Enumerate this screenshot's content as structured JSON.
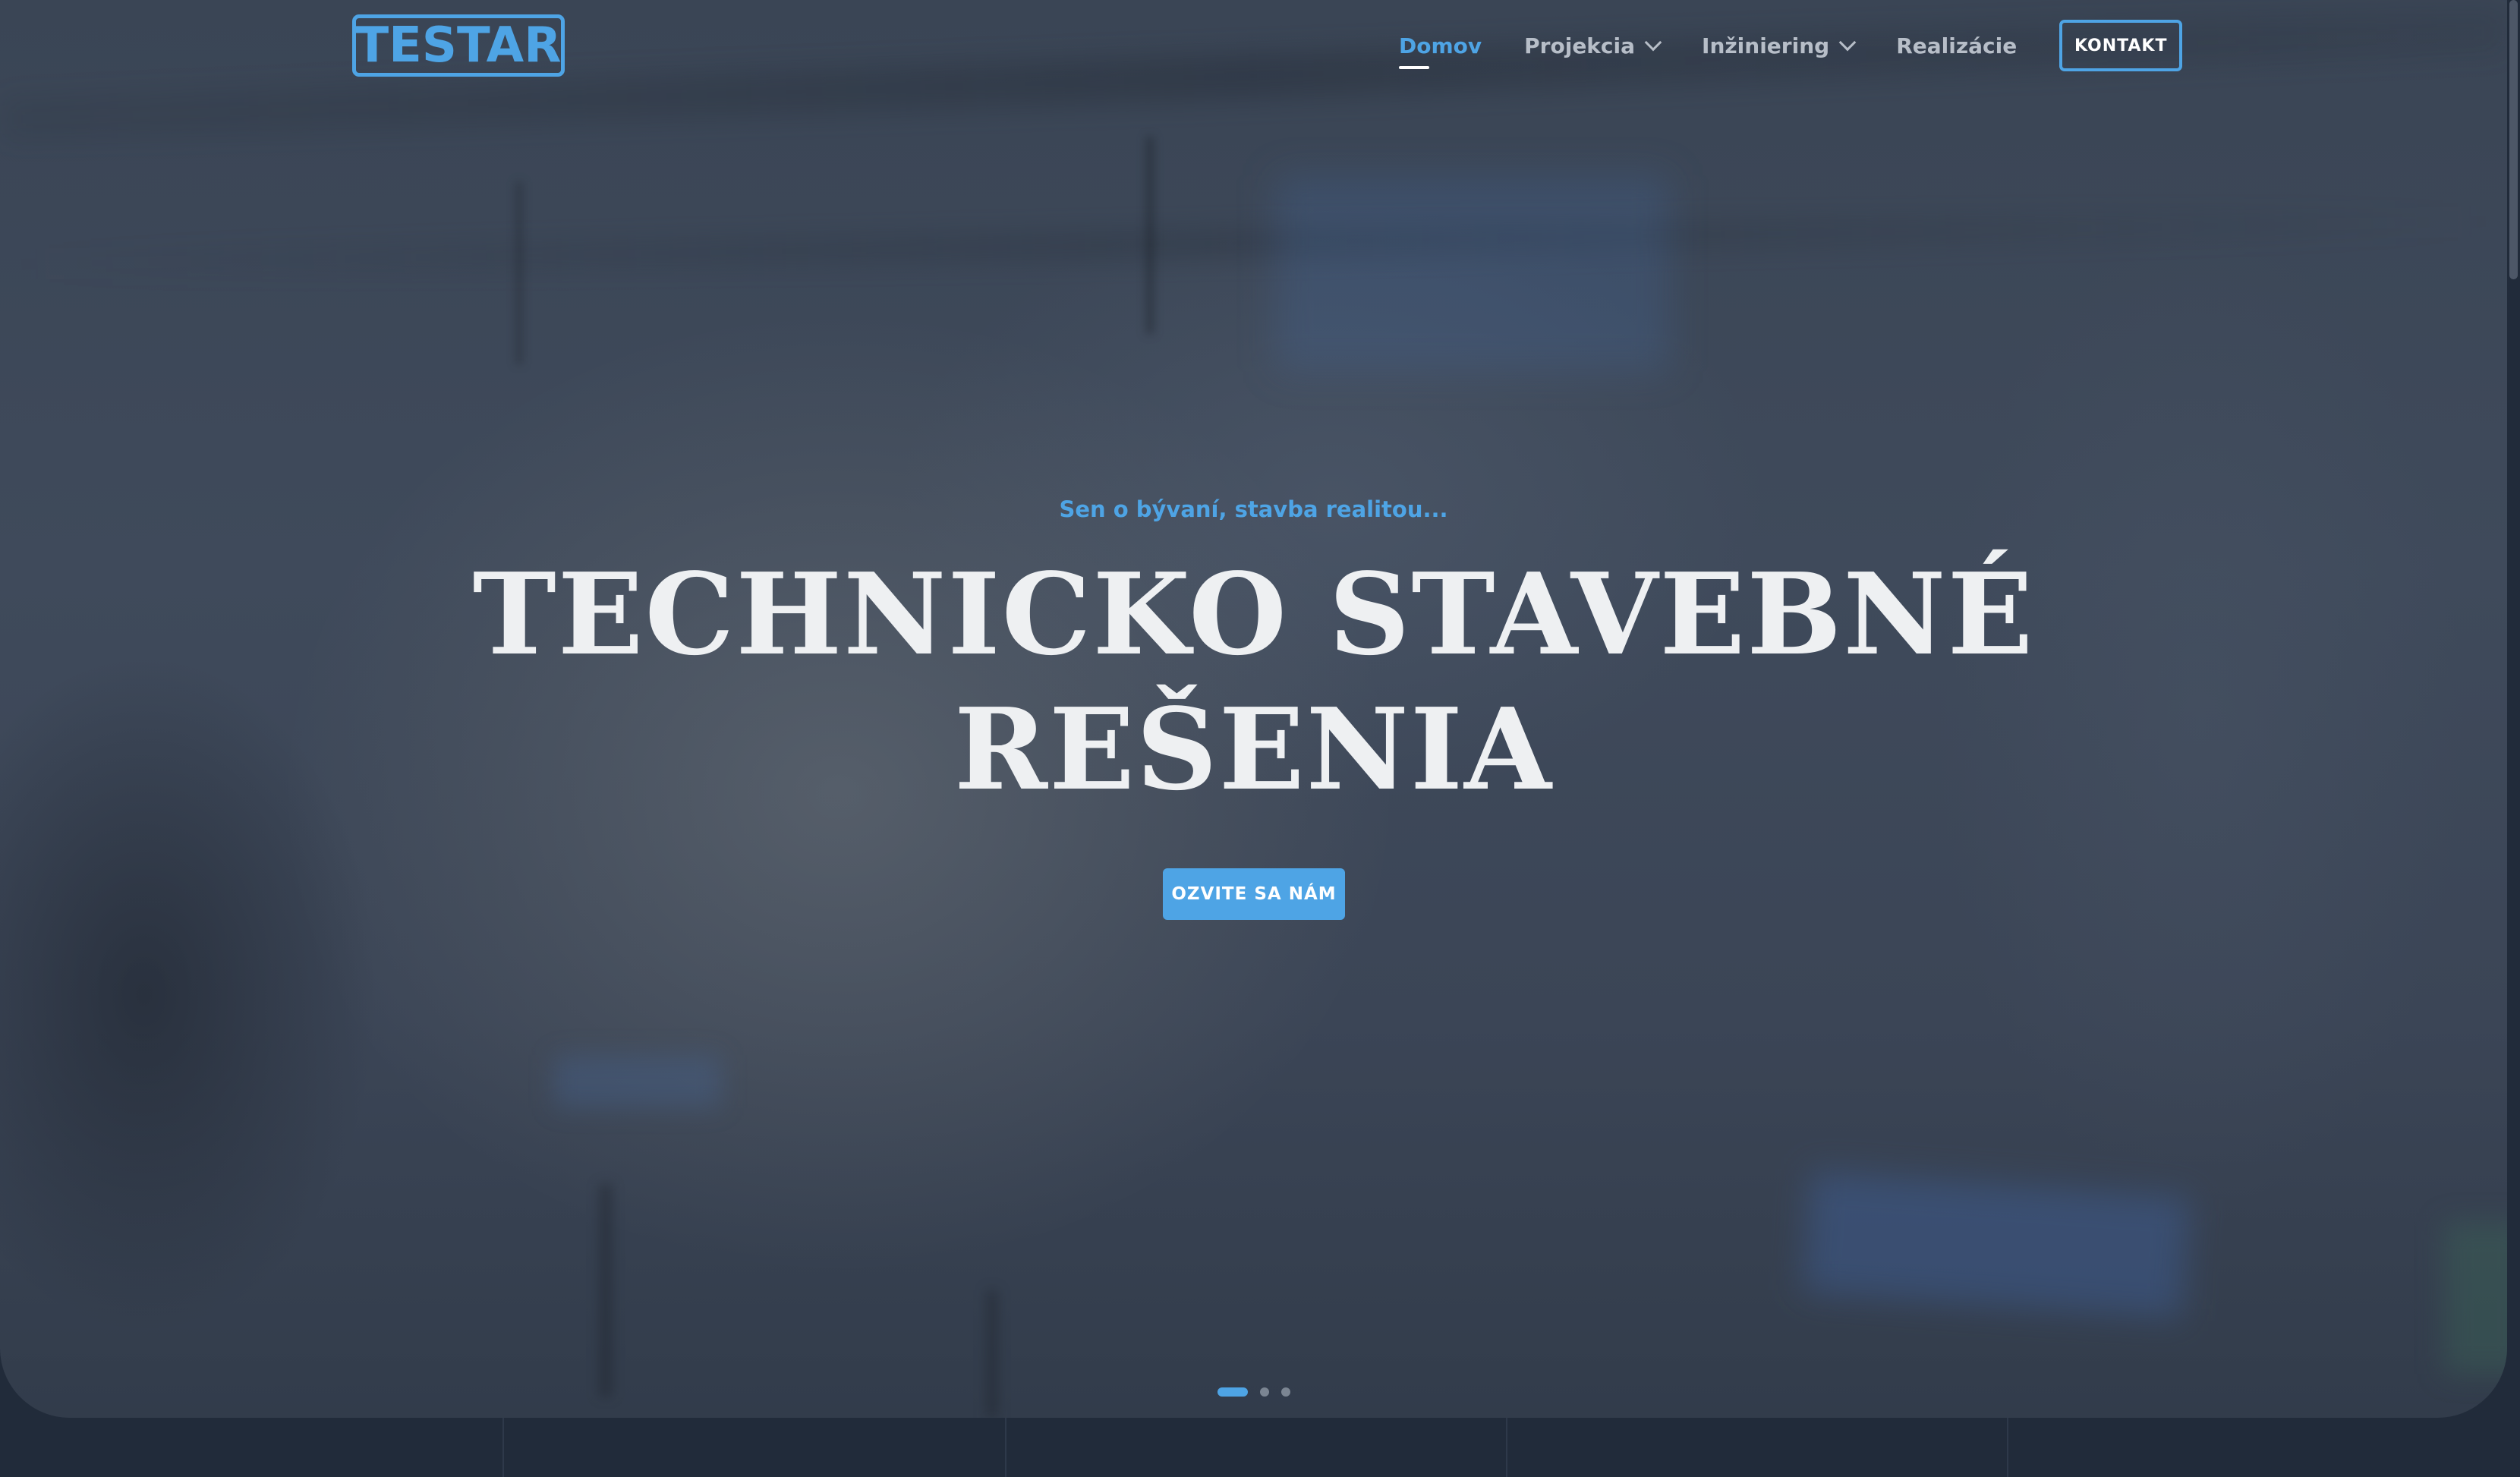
{
  "brand": {
    "logo_text": "TESTAR",
    "accent_color": "#4ea4e5"
  },
  "nav": {
    "items": [
      {
        "label": "Domov",
        "active": true
      },
      {
        "label": "Projekcia",
        "has_dropdown": true,
        "icon": "chevron-down-icon"
      },
      {
        "label": "Inžiniering",
        "has_dropdown": true,
        "icon": "chevron-down-icon"
      },
      {
        "label": "Realizácie"
      }
    ],
    "contact_button": "KONTAKT"
  },
  "hero": {
    "tagline": "Sen o bývaní, stavba realitou...",
    "headline_line1": "TECHNICKO STAVEBNÉ",
    "headline_line2": "REŠENIA",
    "cta_label": "OZVITE SA NÁM"
  },
  "slider": {
    "slide_count": 3,
    "active_index": 0
  }
}
